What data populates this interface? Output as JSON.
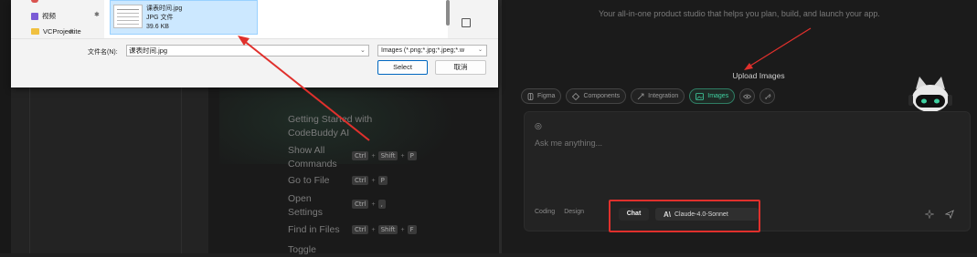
{
  "colors": {
    "accent_green": "#3fd0a0",
    "annotation_red": "#e0302c",
    "dialog_bg": "#f3f3f3",
    "selection_bg": "#cce8ff",
    "panel_bg": "#1b1b1b"
  },
  "welcome": {
    "getting_started": [
      "Getting Started with",
      "CodeBuddy AI"
    ],
    "shortcuts": [
      {
        "label": [
          "Show All",
          "Commands"
        ],
        "keys": [
          "Ctrl",
          "Shift",
          "P"
        ]
      },
      {
        "label": [
          "Go to File"
        ],
        "keys": [
          "Ctrl",
          "P"
        ]
      },
      {
        "label": [
          "Open",
          "Settings"
        ],
        "keys": [
          "Ctrl",
          ","
        ]
      },
      {
        "label": [
          "Find in Files"
        ],
        "keys": [
          "Ctrl",
          "Shift",
          "F"
        ]
      },
      {
        "label": [
          "Toggle"
        ],
        "keys": []
      }
    ]
  },
  "file_dialog": {
    "nav_items": [
      {
        "label": "视频",
        "icon": "video-folder-icon"
      },
      {
        "label": "VCProjectite",
        "icon": "folder-icon"
      }
    ],
    "file": {
      "name": "课表时间.jpg",
      "type": "JPG 文件",
      "size": "39.6 KB"
    },
    "filename_label": "文件名(N):",
    "filename_value": "课表时间.jpg",
    "filetype_value": "Images (*.png;*.jpg;*.jpeg;*.w",
    "select_button": "Select",
    "cancel_button": "取消"
  },
  "panel": {
    "tagline": "Your all-in-one product studio that helps you plan, build, and launch your app.",
    "upload_images": "Upload Images",
    "chips": [
      {
        "label": "Figma",
        "icon": "figma-icon",
        "active": false
      },
      {
        "label": "Components",
        "icon": "components-icon",
        "active": false
      },
      {
        "label": "Integration",
        "icon": "integration-icon",
        "active": false
      },
      {
        "label": "Images",
        "icon": "image-icon",
        "active": true
      }
    ],
    "chat_placeholder": "Ask me anything...",
    "modes": [
      "Coding",
      "Design"
    ],
    "active_mode": "Chat",
    "model": "Claude-4.0-Sonnet"
  }
}
